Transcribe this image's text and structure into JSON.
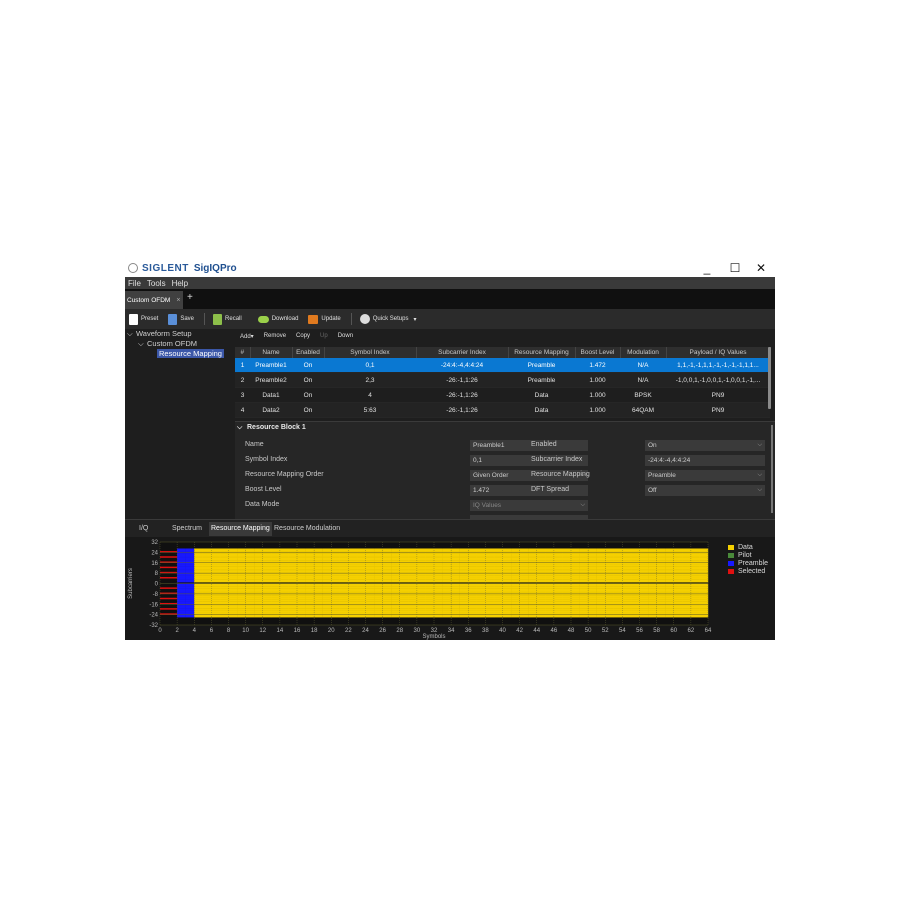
{
  "app": {
    "brand": "SIGLENT",
    "product": "SigIQPro"
  },
  "window_controls": {
    "minimize": "_",
    "maximize": "☐",
    "close": "✕"
  },
  "menu": [
    "File",
    "Tools",
    "Help"
  ],
  "tabs": {
    "doc_tab": "Custom OFDM",
    "close": "×",
    "add": "+"
  },
  "toolbar": {
    "preset": "Preset",
    "save": "Save",
    "recall": "Recall",
    "download": "Download",
    "update": "Update",
    "quick_setups": "Quick Setups",
    "caret": "▾",
    "colors": {
      "preset": "#ffffff",
      "save": "#5a8fd8",
      "recall": "#8dbf4a",
      "download": "#9ad04a",
      "update": "#e07a1f",
      "quick": "#dddddd"
    }
  },
  "tree": {
    "root": "Waveform Setup",
    "child": "Custom OFDM",
    "leaf": "Resource Mapping",
    "expand": "⌵"
  },
  "table_toolbar": {
    "add": "Add▾",
    "remove": "Remove",
    "copy": "Copy",
    "up": "Up",
    "down": "Down"
  },
  "resource_table": {
    "headers": [
      "#",
      "Name",
      "Enabled",
      "Symbol Index",
      "Subcarrier Index",
      "Resource Mapping",
      "Boost Level",
      "Modulation",
      "Payload / IQ Values"
    ],
    "rows": [
      [
        "1",
        "Preamble1",
        "On",
        "0,1",
        "-24:4:-4,4:4:24",
        "Preamble",
        "1.472",
        "N/A",
        "1,1,-1,-1,1,1,-1,-1,-1,-1,1,1..."
      ],
      [
        "2",
        "Preamble2",
        "On",
        "2,3",
        "-26:-1,1:26",
        "Preamble",
        "1.000",
        "N/A",
        "-1,0,0,1,-1,0,0,1,-1,0,0,1,-1,..."
      ],
      [
        "3",
        "Data1",
        "On",
        "4",
        "-26:-1,1:26",
        "Data",
        "1.000",
        "BPSK",
        "PN9"
      ],
      [
        "4",
        "Data2",
        "On",
        "5:63",
        "-26:-1,1:26",
        "Data",
        "1.000",
        "64QAM",
        "PN9"
      ]
    ]
  },
  "resource_block": {
    "title": "Resource Block 1",
    "name_label": "Name",
    "name_value": "Preamble1",
    "symbol_label": "Symbol Index",
    "symbol_value": "0,1",
    "order_label": "Resource Mapping Order",
    "order_value": "Given Order",
    "boost_label": "Boost Level",
    "boost_value": "1.472",
    "datamode_label": "Data Mode",
    "datamode_value": "IQ Values",
    "enabled_label": "Enabled",
    "enabled_value": "On",
    "subcarrier_label": "Subcarrier Index",
    "subcarrier_value": "-24:4:-4,4:4:24",
    "mapping_label": "Resource Mapping",
    "mapping_value": "Preamble",
    "dft_label": "DFT Spread",
    "dft_value": "Off"
  },
  "bottom_tabs": [
    "I/Q",
    "Spectrum",
    "Resource Mapping",
    "Resource Modulation"
  ],
  "chart_data": {
    "type": "heatmap",
    "xlabel": "Symbols",
    "ylabel": "Subcarriers",
    "x_ticks": [
      0,
      2,
      4,
      6,
      8,
      10,
      12,
      14,
      16,
      18,
      20,
      22,
      24,
      26,
      28,
      30,
      32,
      34,
      36,
      38,
      40,
      42,
      44,
      46,
      48,
      50,
      52,
      54,
      56,
      58,
      60,
      62,
      64
    ],
    "y_ticks": [
      32,
      24,
      16,
      8,
      0,
      -8,
      -16,
      -24,
      -32
    ],
    "xlim": [
      0,
      64
    ],
    "ylim": [
      -32,
      32
    ],
    "legend": [
      {
        "name": "Data",
        "color": "#f5d000"
      },
      {
        "name": "Pilot",
        "color": "#4a8a3a"
      },
      {
        "name": "Preamble",
        "color": "#1818ff"
      },
      {
        "name": "Selected",
        "color": "#e01010"
      }
    ],
    "regions": [
      {
        "type": "Selected",
        "symbols": [
          0,
          1
        ],
        "subcarriers": "-24:4:-4,4:4:24"
      },
      {
        "type": "Preamble",
        "symbols": [
          2,
          3
        ],
        "subcarriers": "-26:-1,1:26"
      },
      {
        "type": "Data",
        "symbols": [
          4,
          63
        ],
        "subcarriers": "-26:-1,1:26"
      }
    ]
  }
}
